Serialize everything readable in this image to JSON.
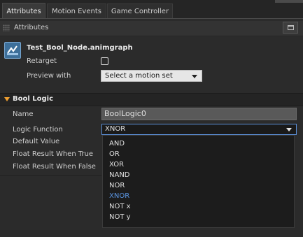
{
  "tabs": [
    {
      "label": "Attributes",
      "active": true
    },
    {
      "label": "Motion Events",
      "active": false
    },
    {
      "label": "Game Controller",
      "active": false
    }
  ],
  "panel": {
    "title": "Attributes"
  },
  "file": {
    "name": "Test_Bool_Node.animgraph",
    "retarget_label": "Retarget",
    "retarget_checked": false,
    "preview_label": "Preview with",
    "preview_value": "Select a motion set"
  },
  "section": {
    "title": "Bool Logic"
  },
  "properties": {
    "name_label": "Name",
    "name_value": "BoolLogic0",
    "logic_label": "Logic Function",
    "logic_value": "XNOR",
    "default_label": "Default Value",
    "float_true_label": "Float Result When True",
    "float_false_label": "Float Result When False"
  },
  "dropdown": {
    "options": [
      "AND",
      "OR",
      "XOR",
      "NAND",
      "NOR",
      "XNOR",
      "NOT x",
      "NOT y"
    ],
    "selected": "XNOR"
  },
  "colors": {
    "accent": "#5a94e0",
    "section_marker": "#f0a030",
    "background": "#2b2b2b"
  }
}
